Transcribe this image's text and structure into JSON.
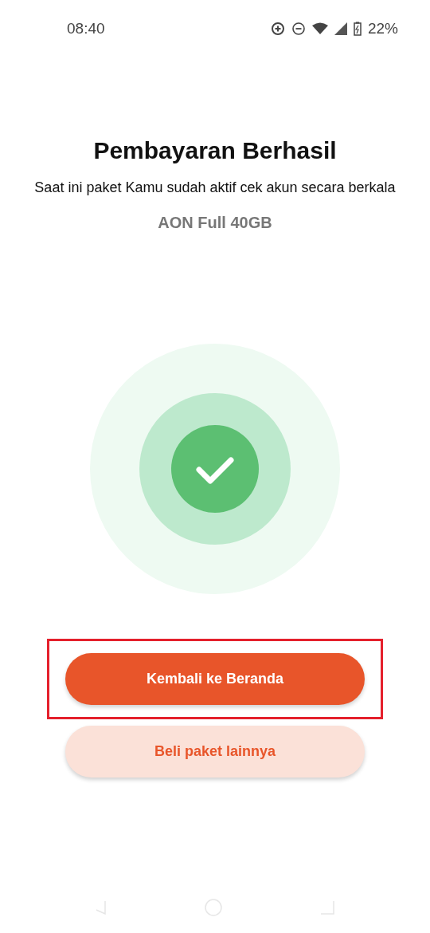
{
  "status_bar": {
    "time": "08:40",
    "battery": "22%"
  },
  "title": "Pembayaran Berhasil",
  "message": "Saat ini paket Kamu sudah aktif cek akun secara berkala",
  "package_name": "AON Full 40GB",
  "buttons": [
    {
      "label": "Kembali ke Beranda",
      "kind": "primary",
      "highlighted": true
    },
    {
      "label": "Beli paket lainnya",
      "kind": "secondary",
      "highlighted": false
    }
  ]
}
